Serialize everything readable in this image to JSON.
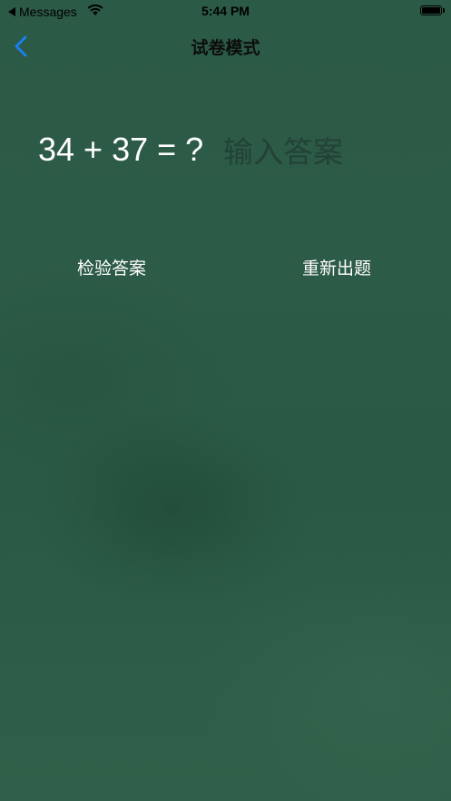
{
  "status_bar": {
    "back_app": "Messages",
    "time": "5:44 PM"
  },
  "nav": {
    "title": "试卷模式",
    "back_icon": "chevron-left-icon",
    "accent_color": "#1a7ff0"
  },
  "quiz": {
    "question": "34 + 37 = ?",
    "answer_value": "",
    "answer_placeholder": "输入答案"
  },
  "actions": {
    "check_label": "检验答案",
    "new_label": "重新出题"
  },
  "theme": {
    "background": "#2c5b47",
    "text": "#ffffff"
  }
}
